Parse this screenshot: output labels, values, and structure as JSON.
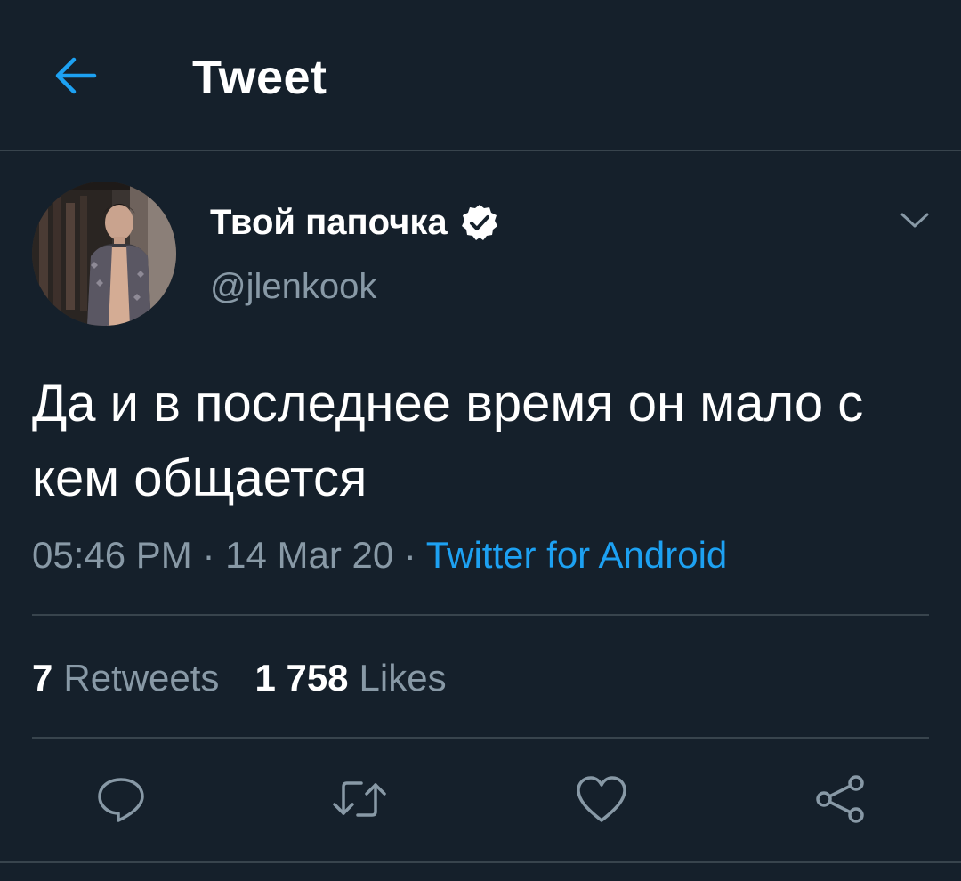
{
  "header": {
    "title": "Tweet",
    "back_icon": "arrow-left-icon"
  },
  "tweet": {
    "author": {
      "display_name": "Твой папочка",
      "handle": "@jlenkook",
      "verified": true,
      "verified_icon": "verified-badge-icon"
    },
    "text": "Да и в последнее время он мало с кем общается",
    "time": "05:46 PM",
    "date": "14 Mar 20",
    "source": "Twitter for Android",
    "separator": " · "
  },
  "stats": {
    "retweets_count": "7",
    "retweets_label": "Retweets",
    "likes_count": "1 758",
    "likes_label": "Likes"
  },
  "actions": {
    "reply_icon": "reply-icon",
    "retweet_icon": "retweet-icon",
    "like_icon": "heart-icon",
    "share_icon": "share-icon"
  },
  "colors": {
    "background": "#15202b",
    "accent": "#1da1f2",
    "secondary_text": "#8899a6",
    "divider": "#38444d"
  }
}
